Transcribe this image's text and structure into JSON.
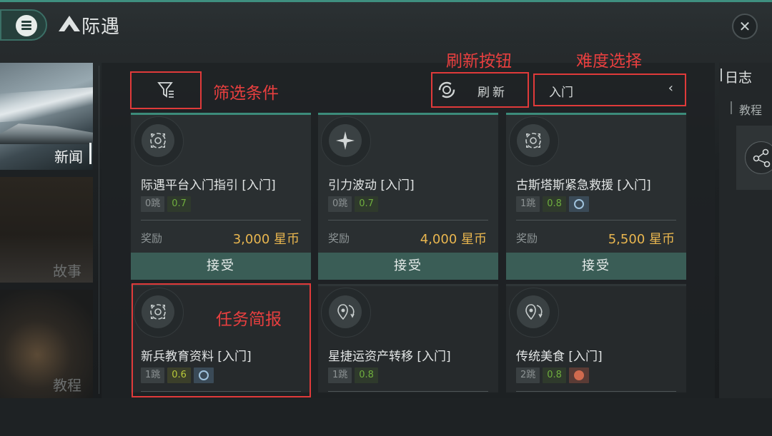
{
  "header": {
    "title": "际遇",
    "close_glyph": "✕"
  },
  "leftnav": {
    "items": [
      {
        "label": "新闻",
        "active": true
      },
      {
        "label": "故事",
        "active": false
      },
      {
        "label": "教程",
        "active": false
      }
    ]
  },
  "toolbar": {
    "refresh_label": "刷新",
    "difficulty_value": "入门",
    "difficulty_chevron": "‹"
  },
  "annotations": {
    "filter": "筛选条件",
    "refresh": "刷新按钮",
    "difficulty": "难度选择",
    "brief": "任务简报"
  },
  "missions": [
    {
      "title": "际遇平台入门指引 [入门]",
      "jumps": "0跳",
      "security": "0.7",
      "faction": null,
      "reward_label": "奖励",
      "reward": "3,000 星币",
      "accept": "接受",
      "icon": "target-icon"
    },
    {
      "title": "引力波动 [入门]",
      "jumps": "0跳",
      "security": "0.7",
      "faction": null,
      "reward_label": "奖励",
      "reward": "4,000 星币",
      "accept": "接受",
      "icon": "star-icon"
    },
    {
      "title": "古斯塔斯紧急救援 [入门]",
      "jumps": "1跳",
      "security": "0.8",
      "faction": "gallente-icon",
      "reward_label": "奖励",
      "reward": "5,500 星币",
      "accept": "接受",
      "icon": "target-icon"
    },
    {
      "title": "新兵教育资料 [入门]",
      "jumps": "1跳",
      "security": "0.6",
      "faction": "gallente-icon",
      "icon": "target-icon"
    },
    {
      "title": "星捷运资产转移 [入门]",
      "jumps": "1跳",
      "security": "0.8",
      "faction": null,
      "icon": "transport-icon"
    },
    {
      "title": "传统美食 [入门]",
      "jumps": "2跳",
      "security": "0.8",
      "faction": "food-icon",
      "icon": "transport-icon"
    }
  ],
  "rightpanel": {
    "header": "日志",
    "tab": "教程"
  },
  "colors": {
    "accent": "#3c8b7a",
    "reward": "#e9b64f",
    "annotation": "#e03a3a"
  }
}
